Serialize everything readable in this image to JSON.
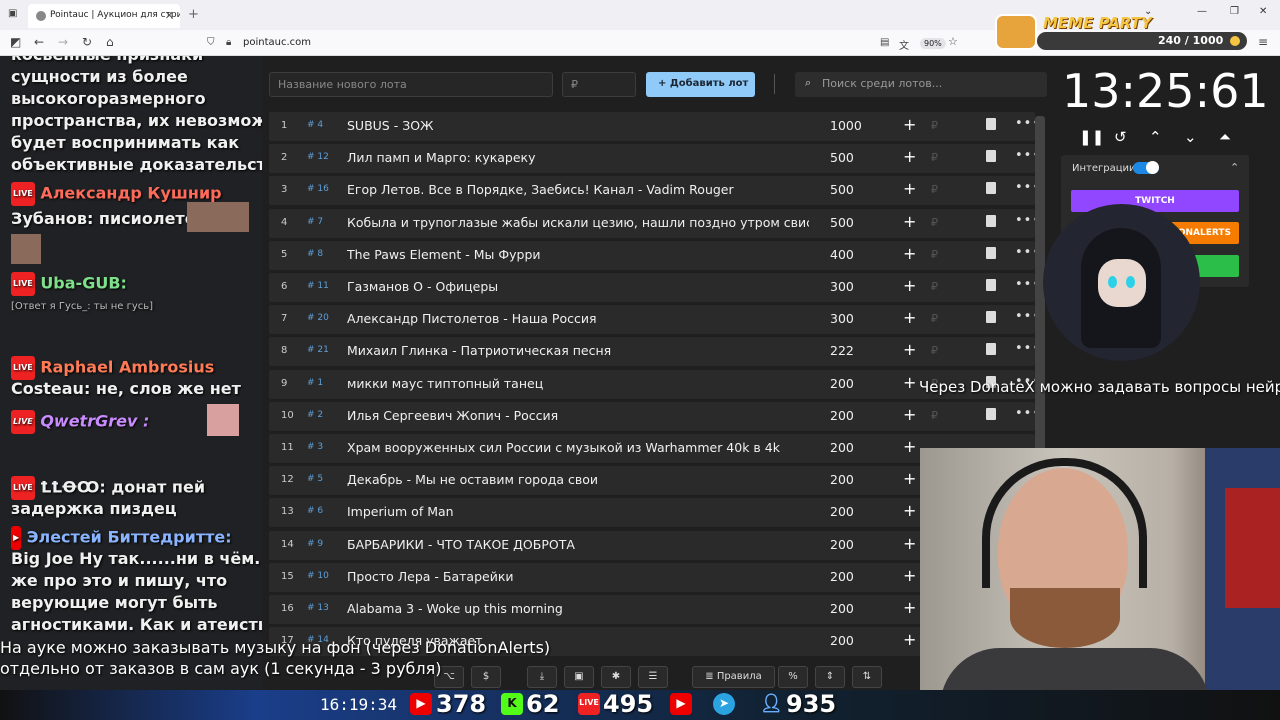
{
  "browser": {
    "tab_title": "Pointauc | Аукцион для стримеров",
    "url": "pointauc.com",
    "zoom": "90%"
  },
  "meme": {
    "title": "MEME PARTY",
    "progress": "240 / 1000",
    "progress_fraction": 0.24
  },
  "chat": {
    "lines": [
      "косвенные признаки",
      "сущности из более",
      "высокогоразмерного",
      "пространства, их невозможно",
      "будет воспринимать как",
      "объективные доказательства",
      "Александр Кушнир",
      "Зубанов: писиолетов",
      "Uba-GUB:",
      "[Ответ я Гусь_: ты не гусь]",
      "Raphael Ambrosius",
      "Costeau: не, слов же нет",
      "QwetrGrev :",
      "ꝈꝈꝊꝎ: донат пей",
      "задержка пиздец",
      "Элестей Биттедритте:",
      "Big Joe Hy так......ни в чём. Я",
      "же про это и пишу, что",
      "верующие могут быть",
      "агностиками. Как и атеисты."
    ]
  },
  "form": {
    "lot_placeholder": "Название нового лота",
    "amount_placeholder": "₽",
    "add_button": "Добавить лот",
    "search_placeholder": "Поиск среди лотов..."
  },
  "lots": [
    {
      "n": "1",
      "id": "# 4",
      "name": "SUBUS - ЗОЖ",
      "amount": "1000"
    },
    {
      "n": "2",
      "id": "# 12",
      "name": "Лил памп и Марго: кукареку",
      "amount": "500"
    },
    {
      "n": "3",
      "id": "# 16",
      "name": "Егор Летов. Все в Порядке, Заебись! Канал - Vadim Rouger",
      "amount": "500"
    },
    {
      "n": "4",
      "id": "# 7",
      "name": "Кобыла и трупоглазые жабы искали цезию, нашли поздно утром свистящего хна",
      "amount": "500"
    },
    {
      "n": "5",
      "id": "# 8",
      "name": "The Paws Element - Мы Фурри",
      "amount": "400"
    },
    {
      "n": "6",
      "id": "# 11",
      "name": "Газманов О - Офицеры",
      "amount": "300"
    },
    {
      "n": "7",
      "id": "# 20",
      "name": "Александр Пистолетов - Наша Россия",
      "amount": "300"
    },
    {
      "n": "8",
      "id": "# 21",
      "name": "Михаил Глинка - Патриотическая песня",
      "amount": "222"
    },
    {
      "n": "9",
      "id": "# 1",
      "name": "микки маус типтопный танец",
      "amount": "200"
    },
    {
      "n": "10",
      "id": "# 2",
      "name": "Илья Сергеевич Жопич - Россия",
      "amount": "200"
    },
    {
      "n": "11",
      "id": "# 3",
      "name": "Храм вооруженных сил России с музыкой из Warhammer 40k в 4k",
      "amount": "200"
    },
    {
      "n": "12",
      "id": "# 5",
      "name": "Декабрь - Мы не оставим города свои",
      "amount": "200"
    },
    {
      "n": "13",
      "id": "# 6",
      "name": "Imperium of Man",
      "amount": "200"
    },
    {
      "n": "14",
      "id": "# 9",
      "name": "БАРБАРИКИ - ЧТО ТАКОЕ ДОБРОТА",
      "amount": "200"
    },
    {
      "n": "15",
      "id": "# 10",
      "name": "Просто Лера - Батарейки",
      "amount": "200"
    },
    {
      "n": "16",
      "id": "# 13",
      "name": "Alabama 3 - Woke up this morning",
      "amount": "200"
    },
    {
      "n": "17",
      "id": "# 14",
      "name": "Кто пуделя уважает",
      "amount": "200"
    }
  ],
  "toolbar": {
    "rules": "Правила",
    "percent": "%"
  },
  "timer": {
    "value": "13:25:61"
  },
  "integrations": {
    "label": "Интеграции",
    "twitch": "TWITCH",
    "da": "DONATIONALERTS"
  },
  "overlay": {
    "donatex": "Через DonateX можно задавать вопросы нейросети",
    "line1": "На ауке можно заказывать музыку на фон (через DonationAlerts)",
    "line2": "отдельно от заказов в сам аук (1 секунда - 3 рубля)"
  },
  "stats": {
    "clock": "16:19:34",
    "youtube": "378",
    "kick": "62",
    "vk": "495",
    "telegram": "935"
  },
  "colors": {
    "accent": "#90caf9",
    "twitch": "#9147ff",
    "donationalerts": "#f57c00",
    "green": "#2bbf4a"
  }
}
